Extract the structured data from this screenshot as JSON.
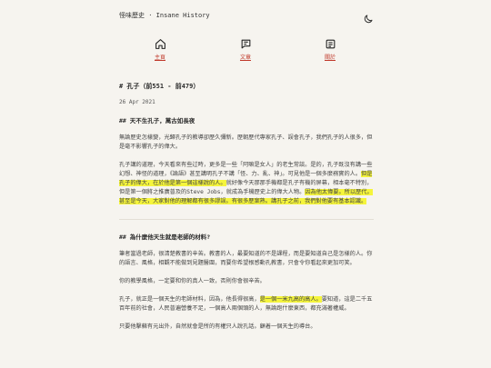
{
  "header": {
    "site_title": "怪味歷史 · Insane History"
  },
  "nav": {
    "items": [
      {
        "label": "主頁",
        "icon": "home-icon"
      },
      {
        "label": "文章",
        "icon": "article-icon"
      },
      {
        "label": "關於",
        "icon": "about-icon"
      }
    ]
  },
  "post": {
    "title": "# 孔子（前551 - 前479）",
    "date": "26 Apr 2021",
    "section1_heading": "## 天不生孔子，萬古如長夜",
    "p1": "無論歷史怎樣變，光歸孔子的教導卻歷久彌新。歷朝歷代專家孔子、誤會孔子，我們孔子的人很多，但是毫不影響孔子的偉大。",
    "p2_a": "孔子講的道理，今天看來有些过時，更多是一些「阿嘛是女人」的老生常談。是的，孔子既沒有講一些幻想、神怪的道理，《論語》甚至講明孔子不講「怪、力、亂、神」。可見他是一個多麼務實的人。",
    "p2_hl1": "但是孔子的偉大，在於他是第一個這樣說的人。",
    "p2_b": "就好像今天那那手機都是孔子有機的屏幕，相本毫不特別，但是第一個將之推廣普及的Steve Jobs，就成為手機歷史上的偉大人物。",
    "p2_hl2": "因為他太偉要。所以歷代，甚至是今天，大家對他的理解都有很多謬誤。有很多歷案熟。講孔子之前，我們對他要有基本認識。",
    "section2_heading": "## 為什麼他天生就是老師的材料?",
    "p3": "筆者當過老師，很清楚教書的辛苦。教書的人，最要知道的不是課程，而是要知道自己是怎樣的人。你的語言、風格，相觀不能做到見題醫圍，而要你希望根感動孔教書，只會令你看起來更加可笑。",
    "p4": "你的教學風格，一定要和你的真人一致，否則你會很辛苦。",
    "p5_a": "孔子，就正是一個天生的老師材料，因為，他長得很高，",
    "p5_hl": "是一個一米九高的高人。",
    "p5_b": "要知道，這是二千五百年前的社會，人民普遍營養不足，一個高人兩個頭的人，無論跑什麼東西，都充滿著權威。",
    "p6": "只要他擊蘇有元出外，自然就會是所的有權只人說孔話。顧着一個天生的導台。"
  }
}
